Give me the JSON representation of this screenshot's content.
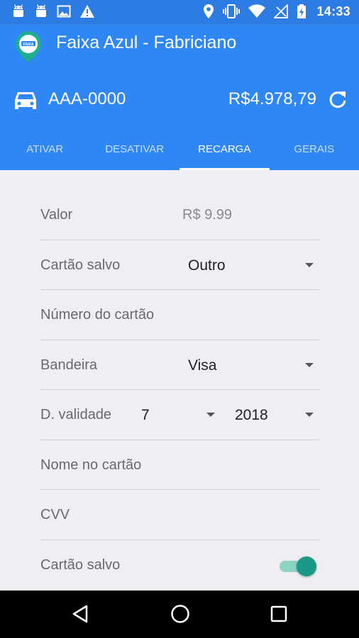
{
  "status_bar": {
    "time": "14:33",
    "left_icons": [
      "android-icon",
      "android-icon",
      "image-icon",
      "warning-icon"
    ],
    "right_icons": [
      "location-icon",
      "vibrate-icon",
      "wifi-icon",
      "no-signal-icon",
      "battery-charging-icon"
    ]
  },
  "app": {
    "title": "Faixa Azul - Fabriciano",
    "plate": "AAA-0000",
    "balance": "R$4.978,79"
  },
  "tabs": [
    {
      "label": "ATIVAR",
      "active": false
    },
    {
      "label": "DESATIVAR",
      "active": false
    },
    {
      "label": "RECARGA",
      "active": true
    },
    {
      "label": "GERAIS",
      "active": false
    }
  ],
  "form": {
    "valor_label": "Valor",
    "valor_value": "R$ 9.99",
    "cartao_salvo_label": "Cartão salvo",
    "cartao_salvo_value": "Outro",
    "numero_placeholder": "Número do cartão",
    "bandeira_label": "Bandeira",
    "bandeira_value": "Visa",
    "validade_label": "D. validade",
    "validade_month": "7",
    "validade_year": "2018",
    "nome_placeholder": "Nome no cartão",
    "cvv_placeholder": "CVV",
    "salvar_label": "Cartão salvo",
    "salvar_on": true
  },
  "colors": {
    "primary": "#2f87f5",
    "status_bar": "#2c7ce3",
    "accent": "#1a9a86",
    "background": "#eeeef3"
  }
}
